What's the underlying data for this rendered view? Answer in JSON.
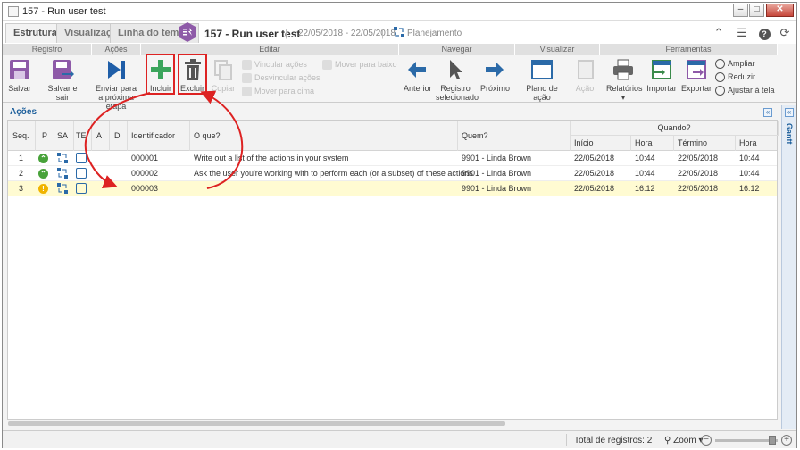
{
  "window": {
    "title": "157 - Run user test"
  },
  "tabs": [
    {
      "label": "Estrutura"
    },
    {
      "label": "Visualização"
    },
    {
      "label": "Linha do tempo"
    }
  ],
  "record": {
    "title": "157 - Run user test",
    "dates": "22/05/2018 - 22/05/2018",
    "status": "Planejamento"
  },
  "ribbon": {
    "groups": [
      "Registro",
      "Ações",
      "Editar",
      "Navegar",
      "Visualizar",
      "Ferramentas"
    ],
    "buttons": {
      "salvar": "Salvar",
      "salvar_sair": "Salvar e sair",
      "enviar": "Enviar para a próxima etapa",
      "incluir": "Incluir",
      "excluir": "Excluir",
      "copiar": "Copiar",
      "vincular": "Vincular ações",
      "desvincular": "Desvincular ações",
      "mover_cima": "Mover para cima",
      "mover_baixo": "Mover para baixo",
      "anterior": "Anterior",
      "registro_sel": "Registro selecionado",
      "proximo": "Próximo",
      "plano": "Plano de ação",
      "acao": "Ação",
      "relatorios": "Relatórios",
      "importar": "Importar",
      "exportar": "Exportar",
      "ampliar": "Ampliar",
      "reduzir": "Reduzir",
      "ajustar": "Ajustar à tela"
    }
  },
  "panel": {
    "title": "Ações",
    "side_label": "Gantt"
  },
  "grid": {
    "headers": {
      "seq": "Seq.",
      "p": "P",
      "sa": "SA",
      "te": "TE",
      "a": "A",
      "d": "D",
      "id": "Identificador",
      "what": "O que?",
      "who": "Quem?",
      "when": "Quando?",
      "start": "Início",
      "hour1": "Hora",
      "end": "Término",
      "hour2": "Hora"
    },
    "rows": [
      {
        "seq": "1",
        "status": "ok",
        "id": "000001",
        "what": "Write out a list of the actions in your system",
        "who": "9901 - Linda Brown",
        "start": "22/05/2018",
        "hour1": "10:44",
        "end": "22/05/2018",
        "hour2": "10:44"
      },
      {
        "seq": "2",
        "status": "ok",
        "id": "000002",
        "what": "Ask the user you're working with to perform each (or a subset) of these actions",
        "who": "9901 - Linda Brown",
        "start": "22/05/2018",
        "hour1": "10:44",
        "end": "22/05/2018",
        "hour2": "10:44"
      },
      {
        "seq": "3",
        "status": "warn",
        "id": "000003",
        "what": "",
        "who": "9901 - Linda Brown",
        "start": "22/05/2018",
        "hour1": "16:12",
        "end": "22/05/2018",
        "hour2": "16:12"
      }
    ]
  },
  "status_bar": {
    "total": "Total de registros: 2",
    "zoom": "Zoom"
  },
  "colors": {
    "accent": "#2b6aa8",
    "highlight": "#d22222",
    "selected_row": "#fffbd2",
    "record_icon": "#8e5aa8"
  }
}
